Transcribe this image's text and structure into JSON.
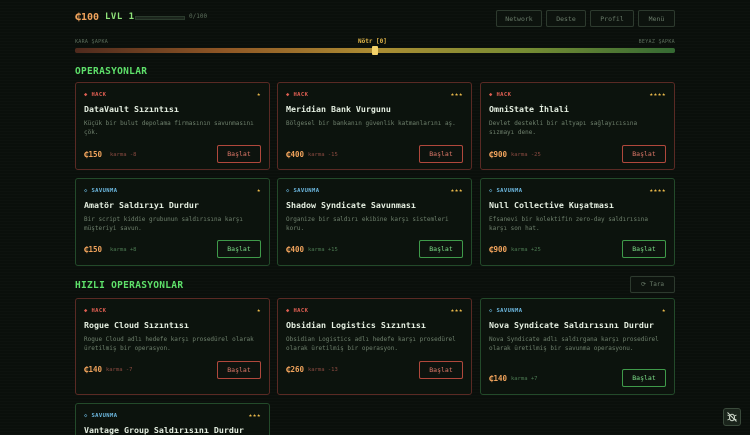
{
  "header": {
    "credits": "₵100",
    "level": "LVL 1",
    "xp_fraction": 0.0,
    "xp_text": "0/100",
    "nav": [
      "Network",
      "Deste",
      "Profil",
      "Menü"
    ]
  },
  "karma": {
    "left": "KARA ŞAPKA",
    "center": "Nötr [0]",
    "right": "BEYAZ ŞAPKA",
    "value": 0
  },
  "sections": {
    "ops": "OPERASYONLAR",
    "quick": "HIZLI OPERASYONLAR",
    "scan_button": "⟳ Tara"
  },
  "cards": [
    {
      "type": "HACK",
      "stars": "★",
      "title": "DataVault Sızıntısı",
      "desc": "Küçük bir bulut depolama firmasının savunmasını çök.",
      "reward": "₵150",
      "karma": "karma -8",
      "button": "Başlat"
    },
    {
      "type": "HACK",
      "stars": "★★★",
      "title": "Meridian Bank Vurgunu",
      "desc": "Bölgesel bir bankanın güvenlik katmanlarını aş.",
      "reward": "₵400",
      "karma": "karma -15",
      "button": "Başlat"
    },
    {
      "type": "HACK",
      "stars": "★★★★",
      "title": "OmniState İhlali",
      "desc": "Devlet destekli bir altyapı sağlayıcısına sızmayı dene.",
      "reward": "₵900",
      "karma": "karma -25",
      "button": "Başlat"
    },
    {
      "type": "SAVUNMA",
      "stars": "★",
      "title": "Amatör Saldırıyı Durdur",
      "desc": "Bir script kiddie grubunun saldırısına karşı müşteriyi savun.",
      "reward": "₵150",
      "karma": "karma +8",
      "button": "Başlat"
    },
    {
      "type": "SAVUNMA",
      "stars": "★★★",
      "title": "Shadow Syndicate Savunması",
      "desc": "Organize bir saldırı ekibine karşı sistemleri koru.",
      "reward": "₵400",
      "karma": "karma +15",
      "button": "Başlat"
    },
    {
      "type": "SAVUNMA",
      "stars": "★★★★",
      "title": "Null Collective Kuşatması",
      "desc": "Efsanevi bir kolektifin zero-day saldırısına karşı son hat.",
      "reward": "₵900",
      "karma": "karma +25",
      "button": "Başlat"
    },
    {
      "type": "HACK",
      "stars": "★",
      "title": "Rogue Cloud Sızıntısı",
      "desc": "Rogue Cloud adlı hedefe karşı prosedürel olarak üretilmiş bir operasyon.",
      "reward": "₵140",
      "karma": "karma -7",
      "button": "Başlat"
    },
    {
      "type": "HACK",
      "stars": "★★★",
      "title": "Obsidian Logistics Sızıntısı",
      "desc": "Obsidian Logistics adlı hedefe karşı prosedürel olarak üretilmiş bir operasyon.",
      "reward": "₵260",
      "karma": "karma -13",
      "button": "Başlat"
    },
    {
      "type": "SAVUNMA",
      "stars": "★",
      "title": "Nova Syndicate Saldırısını Durdur",
      "desc": "Nova Syndicate adlı saldırgana karşı prosedürel olarak üretilmiş bir savunma operasyonu.",
      "reward": "₵140",
      "karma": "karma +7",
      "button": "Başlat"
    },
    {
      "type": "SAVUNMA",
      "stars": "★★★",
      "title": "Vantage Group Saldırısını Durdur",
      "desc": "",
      "reward": "",
      "karma": "",
      "button": ""
    }
  ],
  "colors": {
    "background": "#0a0f0b",
    "accent_green": "#5ee06a",
    "credit_orange": "#f0a35c",
    "hack_red": "#e05f52",
    "defense_blue": "#6cb8e0",
    "star_gold": "#e9b84a"
  },
  "icons": {
    "corner": "bug-slash-icon"
  }
}
